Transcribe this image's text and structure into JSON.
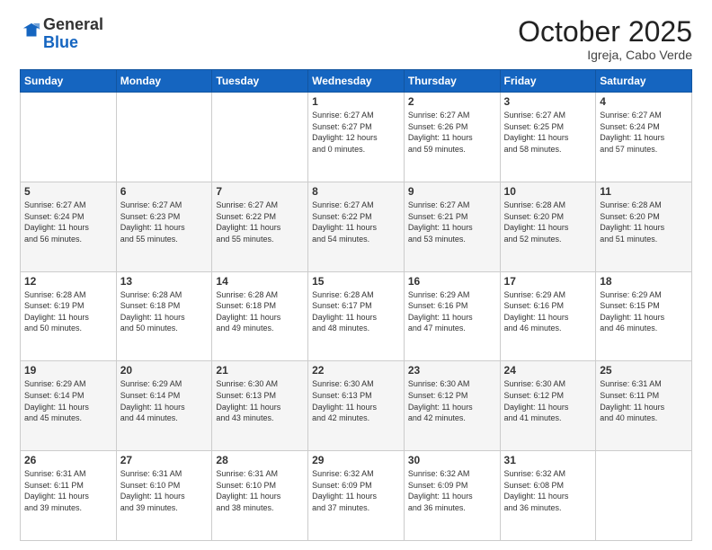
{
  "header": {
    "logo_general": "General",
    "logo_blue": "Blue",
    "month": "October 2025",
    "location": "Igreja, Cabo Verde"
  },
  "days_of_week": [
    "Sunday",
    "Monday",
    "Tuesday",
    "Wednesday",
    "Thursday",
    "Friday",
    "Saturday"
  ],
  "weeks": [
    [
      {
        "day": "",
        "info": ""
      },
      {
        "day": "",
        "info": ""
      },
      {
        "day": "",
        "info": ""
      },
      {
        "day": "1",
        "info": "Sunrise: 6:27 AM\nSunset: 6:27 PM\nDaylight: 12 hours\nand 0 minutes."
      },
      {
        "day": "2",
        "info": "Sunrise: 6:27 AM\nSunset: 6:26 PM\nDaylight: 11 hours\nand 59 minutes."
      },
      {
        "day": "3",
        "info": "Sunrise: 6:27 AM\nSunset: 6:25 PM\nDaylight: 11 hours\nand 58 minutes."
      },
      {
        "day": "4",
        "info": "Sunrise: 6:27 AM\nSunset: 6:24 PM\nDaylight: 11 hours\nand 57 minutes."
      }
    ],
    [
      {
        "day": "5",
        "info": "Sunrise: 6:27 AM\nSunset: 6:24 PM\nDaylight: 11 hours\nand 56 minutes."
      },
      {
        "day": "6",
        "info": "Sunrise: 6:27 AM\nSunset: 6:23 PM\nDaylight: 11 hours\nand 55 minutes."
      },
      {
        "day": "7",
        "info": "Sunrise: 6:27 AM\nSunset: 6:22 PM\nDaylight: 11 hours\nand 55 minutes."
      },
      {
        "day": "8",
        "info": "Sunrise: 6:27 AM\nSunset: 6:22 PM\nDaylight: 11 hours\nand 54 minutes."
      },
      {
        "day": "9",
        "info": "Sunrise: 6:27 AM\nSunset: 6:21 PM\nDaylight: 11 hours\nand 53 minutes."
      },
      {
        "day": "10",
        "info": "Sunrise: 6:28 AM\nSunset: 6:20 PM\nDaylight: 11 hours\nand 52 minutes."
      },
      {
        "day": "11",
        "info": "Sunrise: 6:28 AM\nSunset: 6:20 PM\nDaylight: 11 hours\nand 51 minutes."
      }
    ],
    [
      {
        "day": "12",
        "info": "Sunrise: 6:28 AM\nSunset: 6:19 PM\nDaylight: 11 hours\nand 50 minutes."
      },
      {
        "day": "13",
        "info": "Sunrise: 6:28 AM\nSunset: 6:18 PM\nDaylight: 11 hours\nand 50 minutes."
      },
      {
        "day": "14",
        "info": "Sunrise: 6:28 AM\nSunset: 6:18 PM\nDaylight: 11 hours\nand 49 minutes."
      },
      {
        "day": "15",
        "info": "Sunrise: 6:28 AM\nSunset: 6:17 PM\nDaylight: 11 hours\nand 48 minutes."
      },
      {
        "day": "16",
        "info": "Sunrise: 6:29 AM\nSunset: 6:16 PM\nDaylight: 11 hours\nand 47 minutes."
      },
      {
        "day": "17",
        "info": "Sunrise: 6:29 AM\nSunset: 6:16 PM\nDaylight: 11 hours\nand 46 minutes."
      },
      {
        "day": "18",
        "info": "Sunrise: 6:29 AM\nSunset: 6:15 PM\nDaylight: 11 hours\nand 46 minutes."
      }
    ],
    [
      {
        "day": "19",
        "info": "Sunrise: 6:29 AM\nSunset: 6:14 PM\nDaylight: 11 hours\nand 45 minutes."
      },
      {
        "day": "20",
        "info": "Sunrise: 6:29 AM\nSunset: 6:14 PM\nDaylight: 11 hours\nand 44 minutes."
      },
      {
        "day": "21",
        "info": "Sunrise: 6:30 AM\nSunset: 6:13 PM\nDaylight: 11 hours\nand 43 minutes."
      },
      {
        "day": "22",
        "info": "Sunrise: 6:30 AM\nSunset: 6:13 PM\nDaylight: 11 hours\nand 42 minutes."
      },
      {
        "day": "23",
        "info": "Sunrise: 6:30 AM\nSunset: 6:12 PM\nDaylight: 11 hours\nand 42 minutes."
      },
      {
        "day": "24",
        "info": "Sunrise: 6:30 AM\nSunset: 6:12 PM\nDaylight: 11 hours\nand 41 minutes."
      },
      {
        "day": "25",
        "info": "Sunrise: 6:31 AM\nSunset: 6:11 PM\nDaylight: 11 hours\nand 40 minutes."
      }
    ],
    [
      {
        "day": "26",
        "info": "Sunrise: 6:31 AM\nSunset: 6:11 PM\nDaylight: 11 hours\nand 39 minutes."
      },
      {
        "day": "27",
        "info": "Sunrise: 6:31 AM\nSunset: 6:10 PM\nDaylight: 11 hours\nand 39 minutes."
      },
      {
        "day": "28",
        "info": "Sunrise: 6:31 AM\nSunset: 6:10 PM\nDaylight: 11 hours\nand 38 minutes."
      },
      {
        "day": "29",
        "info": "Sunrise: 6:32 AM\nSunset: 6:09 PM\nDaylight: 11 hours\nand 37 minutes."
      },
      {
        "day": "30",
        "info": "Sunrise: 6:32 AM\nSunset: 6:09 PM\nDaylight: 11 hours\nand 36 minutes."
      },
      {
        "day": "31",
        "info": "Sunrise: 6:32 AM\nSunset: 6:08 PM\nDaylight: 11 hours\nand 36 minutes."
      },
      {
        "day": "",
        "info": ""
      }
    ]
  ]
}
